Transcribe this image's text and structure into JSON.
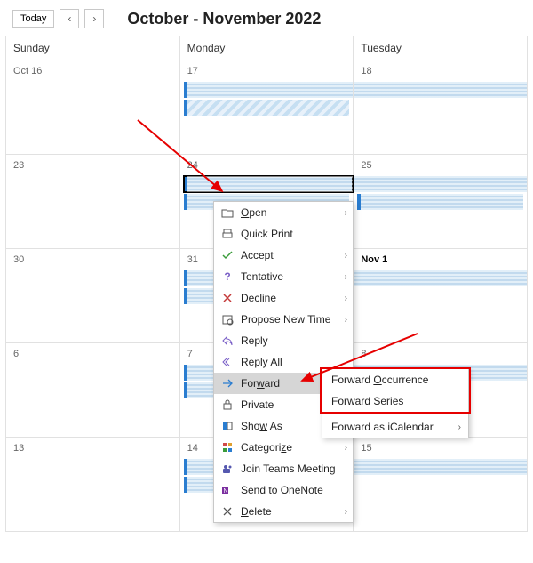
{
  "topbar": {
    "today_label": "Today",
    "prev_label": "‹",
    "next_label": "›",
    "title": "October - November 2022"
  },
  "columns": [
    "Sunday",
    "Monday",
    "Tuesday"
  ],
  "weeks": [
    {
      "days": [
        "Oct 16",
        "17",
        "18"
      ]
    },
    {
      "days": [
        "23",
        "24",
        "25"
      ]
    },
    {
      "days": [
        "30",
        "31",
        "Nov 1"
      ]
    },
    {
      "days": [
        "6",
        "7",
        "8"
      ]
    },
    {
      "days": [
        "13",
        "14",
        "15"
      ]
    }
  ],
  "context_menu": {
    "open": "Open",
    "quick_print": "Quick Print",
    "accept": "Accept",
    "tentative": "Tentative",
    "decline": "Decline",
    "propose": "Propose New Time",
    "reply": "Reply",
    "reply_all": "Reply All",
    "forward": "Forward",
    "private": "Private",
    "show_as": "Show As",
    "categorize": "Categorize",
    "join_teams": "Join Teams Meeting",
    "onenote": "Send to OneNote",
    "delete": "Delete"
  },
  "forward_submenu": {
    "occurrence": "Forward Occurrence",
    "series": "Forward Series",
    "icalendar": "Forward as iCalendar"
  },
  "annotations": {
    "arrow_to_event": true,
    "arrow_to_forward": true,
    "redbox_submenu": true
  }
}
